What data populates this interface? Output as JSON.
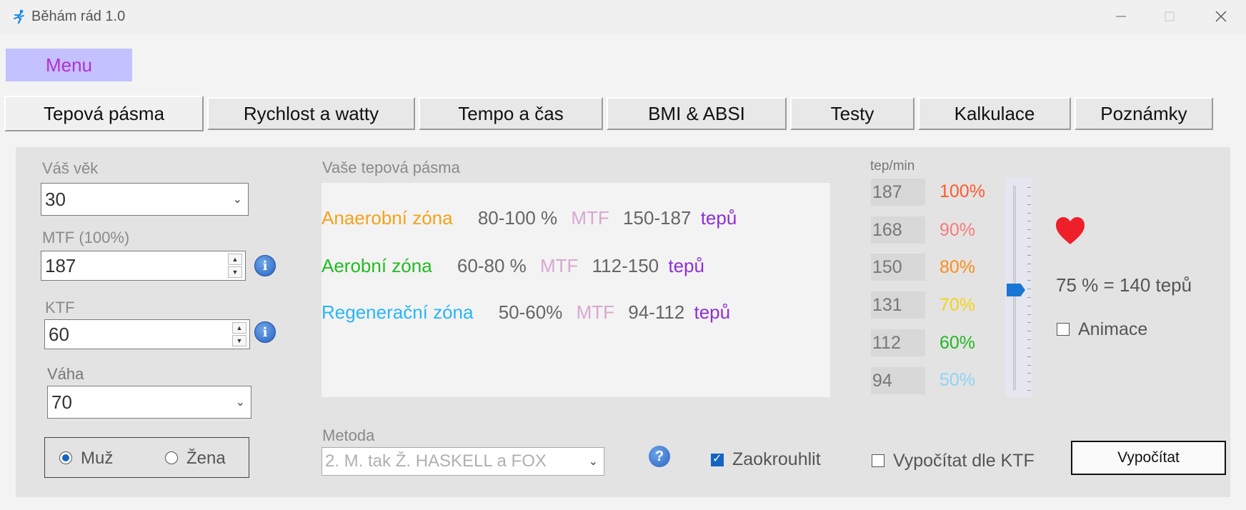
{
  "window": {
    "title": "Běhám rád 1.0"
  },
  "menu": {
    "label": "Menu"
  },
  "tabs": [
    {
      "label": "Tepová pásma",
      "active": true
    },
    {
      "label": "Rychlost a watty"
    },
    {
      "label": "Tempo a čas"
    },
    {
      "label": "BMI  &  ABSI"
    },
    {
      "label": "Testy"
    },
    {
      "label": "Kalkulace"
    },
    {
      "label": "Poznámky"
    }
  ],
  "inputs": {
    "age_label": "Váš věk",
    "age_value": "30",
    "mtf_label": "MTF  (100%)",
    "mtf_value": "187",
    "ktf_label": "KTF",
    "ktf_value": "60",
    "weight_label": "Váha",
    "weight_value": "70",
    "gender": {
      "male": "Muž",
      "female": "Žena",
      "selected": "male"
    }
  },
  "zones": {
    "heading": "Vaše tepová pásma",
    "rows": [
      {
        "name": "Anaerobní zóna",
        "range": "80-100 %",
        "mtf": "MTF",
        "bpm": "150-187",
        "unit": "tepů",
        "color": "#f4a21a"
      },
      {
        "name": "Aerobní zóna",
        "range": "60-80 %",
        "mtf": "MTF",
        "bpm": "112-150",
        "unit": "tepů",
        "color": "#22bb22"
      },
      {
        "name": "Regenerační zóna",
        "range": "50-60%",
        "mtf": "MTF",
        "bpm": "94-112",
        "unit": "tepů",
        "color": "#29b6f6"
      }
    ]
  },
  "scale": {
    "unit_label": "tep/min",
    "rows": [
      {
        "bpm": "187",
        "pct": "100%",
        "color": "#ff5a2c"
      },
      {
        "bpm": "168",
        "pct": "90%",
        "color": "#f77a7a"
      },
      {
        "bpm": "150",
        "pct": "80%",
        "color": "#ff8c1a"
      },
      {
        "bpm": "131",
        "pct": "70%",
        "color": "#f5d21a"
      },
      {
        "bpm": "112",
        "pct": "60%",
        "color": "#20b820"
      },
      {
        "bpm": "94",
        "pct": "50%",
        "color": "#8fd3f5"
      }
    ],
    "slider_value_pct": 75
  },
  "result": {
    "text": "75 %   =   140 tepů",
    "animation_label": "Animace",
    "animation_checked": false
  },
  "method": {
    "label": "Metoda",
    "value": "2.    M. tak Ž.          HASKELL a FOX"
  },
  "options": {
    "round_label": "Zaokrouhlit",
    "round_checked": true,
    "ktf_calc_label": "Vypočítat dle KTF",
    "ktf_calc_checked": false
  },
  "calculate_button": "Vypočítat"
}
